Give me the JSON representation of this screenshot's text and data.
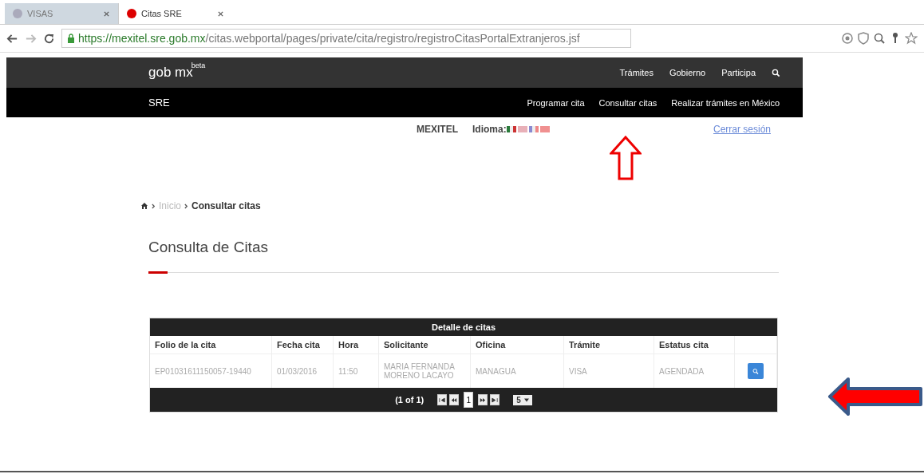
{
  "browser": {
    "tabs": [
      {
        "label": "VISAS",
        "selected": false
      },
      {
        "label": "Citas SRE",
        "selected": true
      }
    ],
    "url": {
      "host": "https://mexitel.sre.gob.mx",
      "path": "/citas.webportal/pages/private/cita/registro/registroCitasPortalExtranjeros.jsf"
    }
  },
  "header": {
    "logo": "gob mx",
    "logo_badge": "beta",
    "nav": [
      "Trámites",
      "Gobierno",
      "Participa"
    ]
  },
  "subheader": {
    "title": "SRE",
    "nav": [
      "Programar cita",
      "Consultar citas",
      "Realizar trámites en México"
    ]
  },
  "userbar": {
    "app": "MEXITEL",
    "language_label": "Idioma:",
    "logout": "Cerrar sesión"
  },
  "breadcrumb": [
    {
      "label": "Inicio",
      "current": false
    },
    {
      "label": "Consultar citas",
      "current": true
    }
  ],
  "page_title": "Consulta de Citas",
  "table": {
    "caption": "Detalle de citas",
    "columns": [
      "Folio de la cita",
      "Fecha cita",
      "Hora",
      "Solicitante",
      "Oficina",
      "Trámite",
      "Estatus cita"
    ],
    "rows": [
      {
        "cells": [
          "EP01031611150057-19440",
          "01/03/2016",
          "11:50",
          "MARIA FERNANDA MORENO LACAYO",
          "MANAGUA",
          "VISA",
          "AGENDADA"
        ]
      }
    ],
    "pager": {
      "summary": "(1 of 1)",
      "pages": [
        {
          "label": "1",
          "selected": true
        }
      ],
      "page_size": "5"
    }
  }
}
